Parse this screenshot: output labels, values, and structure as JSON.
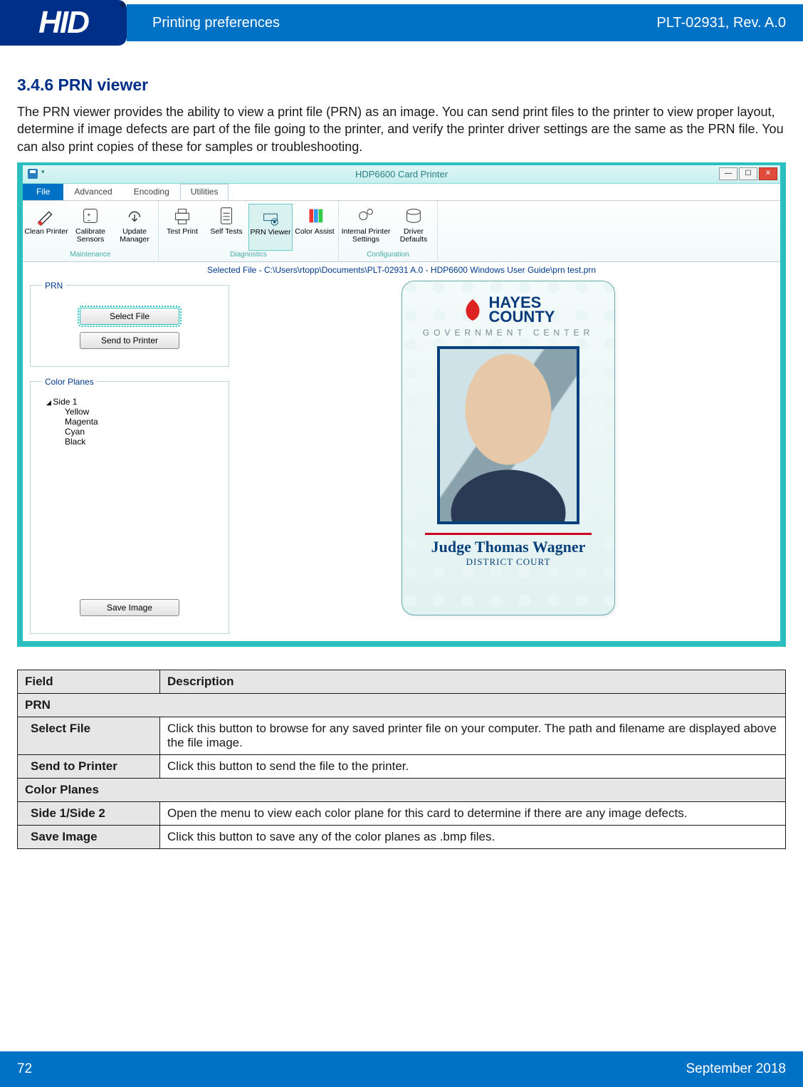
{
  "header": {
    "logo_text": "HID",
    "reg_mark": "®",
    "breadcrumb": "Printing preferences",
    "doc_id": "PLT-02931, Rev. A.0"
  },
  "section": {
    "number_title": "3.4.6 PRN viewer",
    "intro": "The PRN viewer provides the ability to view a print file (PRN) as an image. You can send print files to the printer to view proper layout, determine if image defects are part of the file going to the printer, and verify the printer driver settings are the same as the PRN file. You can also print copies of these for samples or troubleshooting."
  },
  "app": {
    "title": "HDP6600 Card Printer",
    "tabs": {
      "file": "File",
      "advanced": "Advanced",
      "encoding": "Encoding",
      "utilities": "Utilities"
    },
    "groups": {
      "maintenance": {
        "label": "Maintenance",
        "items": [
          "Clean Printer",
          "Calibrate Sensors",
          "Update Manager"
        ]
      },
      "diagnostics": {
        "label": "Diagnostics",
        "items": [
          "Test Print",
          "Self Tests",
          "PRN Viewer",
          "Color Assist"
        ]
      },
      "configuration": {
        "label": "Configuration",
        "items": [
          "Internal Printer Settings",
          "Driver Defaults"
        ]
      }
    },
    "selected_file_label": "Selected File - C:\\Users\\rtopp\\Documents\\PLT-02931 A.0 - HDP6600 Windows User Guide\\prn test.prn",
    "prn_fieldset": "PRN",
    "select_file_btn": "Select File",
    "send_to_printer_btn": "Send to Printer",
    "colorplanes_fieldset": "Color Planes",
    "side_label": "Side 1",
    "planes": [
      "Yellow",
      "Magenta",
      "Cyan",
      "Black"
    ],
    "save_image_btn": "Save Image",
    "card": {
      "county1": "HAYES",
      "county2": "COUNTY",
      "gov": "GOVERNMENT   CENTER",
      "name": "Judge Thomas Wagner",
      "court": "DISTRICT COURT"
    }
  },
  "table": {
    "h_field": "Field",
    "h_desc": "Description",
    "g_prn": "PRN",
    "select_file": "Select File",
    "select_file_desc": "Click this button to browse for any saved printer file on your computer. The path and filename are displayed above the file image.",
    "send": "Send to Printer",
    "send_desc": "Click this button to send the file to the printer.",
    "g_color": "Color Planes",
    "side": "Side 1/Side 2",
    "side_desc": "Open the menu to view each color plane for this card to determine if there are any image defects.",
    "save": "Save Image",
    "save_desc": "Click this button to save any of the color planes as .bmp files."
  },
  "footer": {
    "page": "72",
    "date": "September 2018"
  }
}
